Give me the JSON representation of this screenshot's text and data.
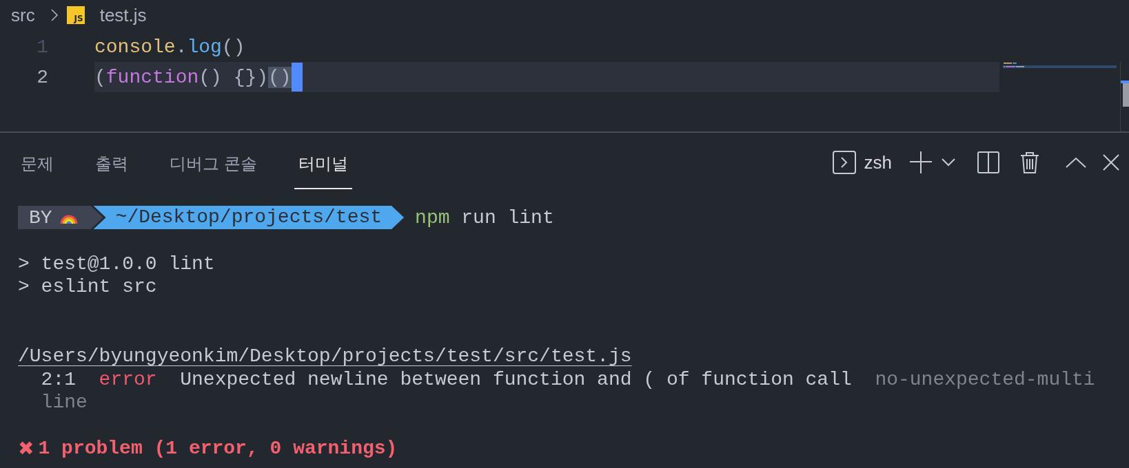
{
  "breadcrumb": [
    {
      "label": "src",
      "kind": "folder"
    },
    {
      "label": "test.js",
      "kind": "js-file",
      "badge": "JS"
    }
  ],
  "editor": {
    "lines": [
      {
        "number": "1",
        "current": false,
        "tokens": [
          {
            "text": "console",
            "kind": "variable",
            "matched": false
          },
          {
            "text": ".",
            "kind": "punct",
            "matched": false
          },
          {
            "text": "log",
            "kind": "function",
            "matched": false
          },
          {
            "text": "()",
            "kind": "punct",
            "matched": false
          }
        ]
      },
      {
        "number": "2",
        "current": true,
        "tokens": [
          {
            "text": "(",
            "kind": "punct",
            "matched": false
          },
          {
            "text": "function",
            "kind": "keyword",
            "matched": false
          },
          {
            "text": "() {})",
            "kind": "punct",
            "matched": false
          },
          {
            "text": "()",
            "kind": "punct",
            "matched": true
          }
        ]
      }
    ]
  },
  "panel": {
    "tabs": [
      {
        "label": "문제",
        "selected": false
      },
      {
        "label": "출력",
        "selected": false
      },
      {
        "label": "디버그 콘솔",
        "selected": false
      },
      {
        "label": "터미널",
        "selected": true
      }
    ],
    "terminal_name": "zsh"
  },
  "terminal": {
    "prompt": {
      "user": "BY",
      "path": "~/Desktop/projects/test",
      "program": "npm",
      "args": "run lint"
    },
    "lines": [
      {
        "kind": "blank"
      },
      {
        "kind": "output",
        "text": "> test@1.0.0 lint"
      },
      {
        "kind": "output",
        "text": "> eslint src"
      },
      {
        "kind": "blank"
      },
      {
        "kind": "blank"
      },
      {
        "kind": "file",
        "text": "/Users/byungyeonkim/Desktop/projects/test/src/test.js"
      },
      {
        "kind": "problem",
        "location": "2:1",
        "severity": "error",
        "message": "Unexpected newline between function and ( of function call",
        "rule": "no-unexpected-multiline"
      },
      {
        "kind": "blank"
      },
      {
        "kind": "summary",
        "icon": "✖",
        "text": "1 problem (1 error, 0 warnings)"
      }
    ]
  }
}
